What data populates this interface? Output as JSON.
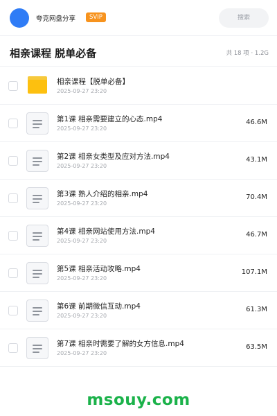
{
  "header": {
    "user_name": "夸克网盘分享",
    "badge": "SVIP",
    "search_placeholder": "搜索"
  },
  "folder": {
    "title": "相亲课程 脱单必备",
    "meta": "共 18 项 · 1.2G"
  },
  "items": [
    {
      "type": "folder",
      "name": "相亲课程【脱单必备】",
      "date": "2025-09-27 23:20",
      "size": ""
    },
    {
      "type": "file",
      "name": "第1课 相亲需要建立的心态.mp4",
      "date": "2025-09-27 23:20",
      "size": "46.6M"
    },
    {
      "type": "file",
      "name": "第2课 相亲女类型及应对方法.mp4",
      "date": "2025-09-27 23:20",
      "size": "43.1M"
    },
    {
      "type": "file",
      "name": "第3课 熟人介绍的相亲.mp4",
      "date": "2025-09-27 23:20",
      "size": "70.4M"
    },
    {
      "type": "file",
      "name": "第4课 相亲网站使用方法.mp4",
      "date": "2025-09-27 23:20",
      "size": "46.7M"
    },
    {
      "type": "file",
      "name": "第5课 相亲活动攻略.mp4",
      "date": "2025-09-27 23:20",
      "size": "107.1M"
    },
    {
      "type": "file",
      "name": "第6课 前期微信互动.mp4",
      "date": "2025-09-27 23:20",
      "size": "61.3M"
    },
    {
      "type": "file",
      "name": "第7课 相亲时需要了解的女方信息.mp4",
      "date": "2025-09-27 23:20",
      "size": "63.5M"
    }
  ],
  "watermark": "msouy.com",
  "colors": {
    "avatar": "#2f7cf6",
    "badge": "#f7931e",
    "folder_icon": "#fdc00f",
    "watermark": "#1bb24a"
  }
}
